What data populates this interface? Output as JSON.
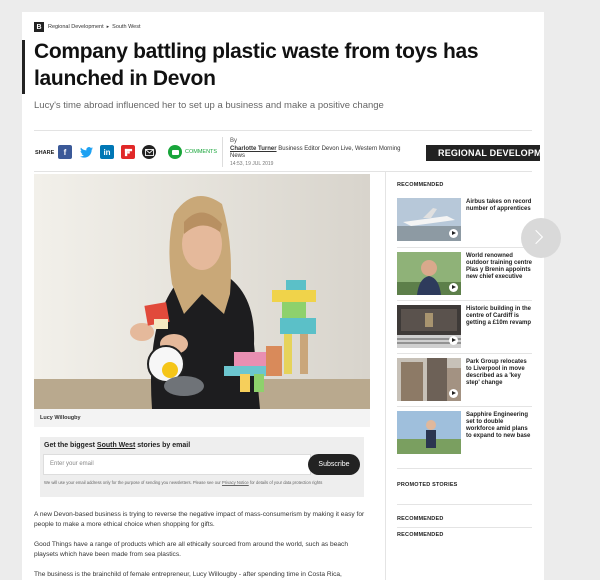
{
  "breadcrumb": {
    "logo": "B",
    "items": [
      "Regional Development",
      "South West"
    ]
  },
  "article": {
    "title": "Company battling plastic waste from toys has launched in Devon",
    "subtitle": "Lucy's time abroad influenced her to set up a business and make a positive change"
  },
  "share": {
    "label": "SHARE",
    "icons": [
      "facebook-icon",
      "twitter-icon",
      "linkedin-icon",
      "flipboard-icon",
      "email-icon"
    ],
    "comments_label": "COMMENTS"
  },
  "byline": {
    "by": "By",
    "author": "Charlotte Turner",
    "role": "Business Editor Devon Live, Western Morning News",
    "date": "14:53, 19 JUL 2019"
  },
  "region_badge": "REGIONAL DEVELOPME",
  "photo": {
    "caption": "Lucy Willougby"
  },
  "newsletter": {
    "title_prefix": "Get the biggest",
    "title_link": "South West",
    "title_suffix": "stories by email",
    "placeholder": "Enter your email",
    "button": "Subscribe",
    "note_prefix": "We will use your email address only for the purpose of sending you newsletters. Please see our",
    "note_link": "Privacy Notice",
    "note_suffix": "for details of your data protection rights"
  },
  "body": {
    "p1": "A new Devon-based business is trying to reverse the negative impact of mass-consumerism by making it easy for people to make a more ethical choice when shopping for gifts.",
    "p2": "Good Things have a range of products which are all ethically sourced from around the world, such as beach playsets which have been made from sea plastics.",
    "p3": "The business is the brainchild of female entrepreneur, Lucy Willougby - after spending time in Costa Rica,"
  },
  "rail": {
    "recommended_label": "RECOMMENDED",
    "items": [
      {
        "text": "Airbus takes on record number of apprentices"
      },
      {
        "text": "World renowned outdoor training centre Plas y Brenin appoints new chief executive"
      },
      {
        "text": "Historic building in the centre of Cardiff is getting a £10m revamp"
      },
      {
        "text": "Park Group relocates to Liverpool in move described as a 'key step' change"
      },
      {
        "text": "Sapphire Engineering set to double workforce amid plans to expand to new base"
      }
    ],
    "promoted_label": "PROMOTED STORIES",
    "recommended_label_2": "RECOMMENDED",
    "recommended_label_3": "RECOMMENDED"
  },
  "colors": {
    "facebook": "#3b5998",
    "twitter": "#1da1f2",
    "linkedin": "#0077b5",
    "flipboard": "#e12828",
    "email": "#222222",
    "comments": "#18a53a"
  }
}
